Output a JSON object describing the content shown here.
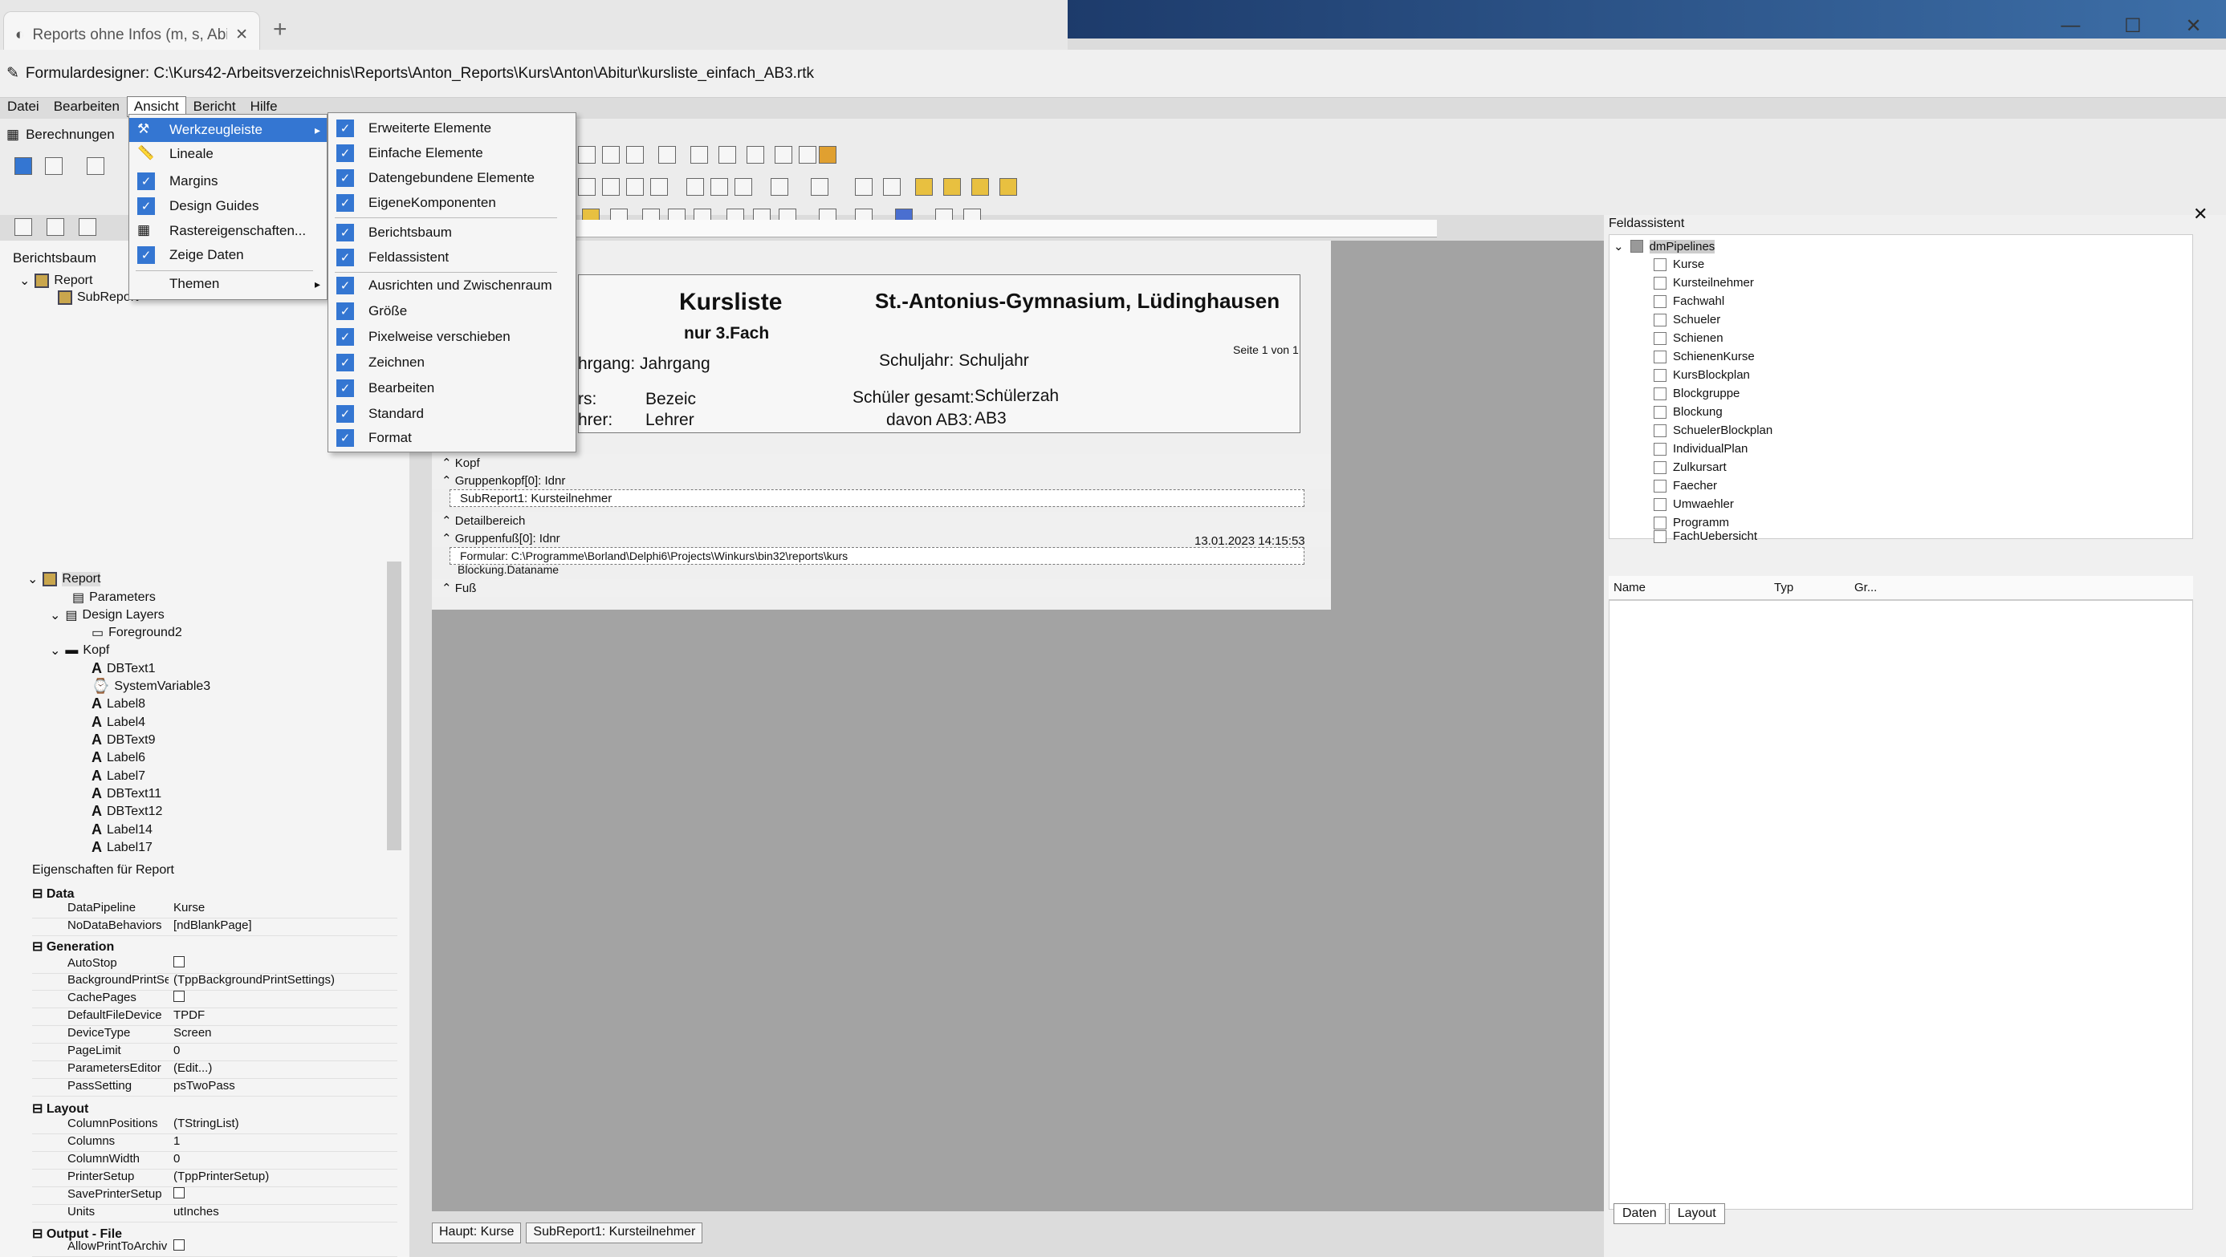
{
  "browser": {
    "tab_title": "Reports ohne Infos (m, s, Abitur)",
    "close_glyph": "✕",
    "new_tab": "+"
  },
  "window": {
    "title": "Formulardesigner: C:\\Kurs42-Arbeitsverzeichnis\\Reports\\Anton_Reports\\Kurs\\Anton\\Abitur\\kursliste_einfach_AB3.rtk",
    "minimize": "—",
    "maximize": "☐",
    "close": "✕"
  },
  "menubar": [
    "Datei",
    "Bearbeiten",
    "Ansicht",
    "Bericht",
    "Hilfe"
  ],
  "toolbar": {
    "calc_label": "Berechnungen"
  },
  "menu_ansicht": [
    {
      "label": "Werkzeugleiste",
      "checked": false,
      "submenu": true
    },
    {
      "label": "Lineale",
      "checked": false
    },
    {
      "label": "Margins",
      "checked": true
    },
    {
      "label": "Design Guides",
      "checked": true
    },
    {
      "label": "Rastereigenschaften...",
      "checked": false
    },
    {
      "label": "Zeige Daten",
      "checked": true
    },
    {
      "label": "Themen",
      "checked": false,
      "submenu": true
    }
  ],
  "menu_werkzeugleiste": [
    "Erweiterte Elemente",
    "Einfache Elemente",
    "Datengebundene Elemente",
    "EigeneKomponenten",
    "Berichtsbaum",
    "Feldassistent",
    "Ausrichten und Zwischenraum",
    "Größe",
    "Pixelweise verschieben",
    "Zeichnen",
    "Bearbeiten",
    "Standard",
    "Format"
  ],
  "left": {
    "tree_title": "Berichtsbaum",
    "tree_top": [
      "Report",
      "SubReport"
    ],
    "tree": [
      "Report",
      "Parameters",
      "Design Layers",
      "Foreground2",
      "Kopf",
      "DBText1",
      "SystemVariable3",
      "Label8",
      "Label4",
      "DBText9",
      "Label6",
      "Label7",
      "DBText11",
      "DBText12",
      "Label14",
      "Label17"
    ],
    "props_title": "Eigenschaften für Report",
    "sections": {
      "data": "Data",
      "generation": "Generation",
      "layout": "Layout",
      "output": "Output - File"
    },
    "props_data": [
      [
        "DataPipeline",
        "Kurse"
      ],
      [
        "NoDataBehaviors",
        "[ndBlankPage]"
      ]
    ],
    "props_generation": [
      [
        "AutoStop",
        ""
      ],
      [
        "BackgroundPrintSe",
        "(TppBackgroundPrintSettings)"
      ],
      [
        "CachePages",
        ""
      ],
      [
        "DefaultFileDevice",
        "TPDF"
      ],
      [
        "DeviceType",
        "Screen"
      ],
      [
        "PageLimit",
        "0"
      ],
      [
        "ParametersEditor",
        "(Edit...)"
      ],
      [
        "PassSetting",
        "psTwoPass"
      ]
    ],
    "props_layout": [
      [
        "ColumnPositions",
        "(TStringList)"
      ],
      [
        "Columns",
        "1"
      ],
      [
        "ColumnWidth",
        "0"
      ],
      [
        "PrinterSetup",
        "(TppPrinterSetup)"
      ],
      [
        "SavePrinterSetup",
        ""
      ],
      [
        "Units",
        "utInches"
      ]
    ],
    "props_output": [
      [
        "AllowPrintToArchiv",
        ""
      ]
    ]
  },
  "report": {
    "title": "Kursliste",
    "school": "St.-Antonius-Gymnasium, Lüdinghausen",
    "subtitle": "nur 3.Fach",
    "jahrgang": "hrgang: Jahrgang",
    "schuljahr": "Schuljahr: Schuljahr",
    "seite": "Seite 1 von 1",
    "kurs_label": "rs:",
    "kurs_value": "Bezeic",
    "lehrer_label": "hrer:",
    "lehrer_value": "Lehrer",
    "schueler_label": "Schüler gesamt:",
    "schueler_value": "Schülerzah",
    "ab3_label": "davon AB3:",
    "ab3_value": "AB3",
    "bands": {
      "kopf": "Kopf",
      "gruppenkopf": "Gruppenkopf[0]: Idnr",
      "subreport": "SubReport1: Kursteilnehmer",
      "detail": "Detailbereich",
      "gruppenfuss": "Gruppenfuß[0]: Idnr",
      "formular": "Formular: C:\\Programme\\Borland\\Delphi6\\Projects\\Winkurs\\bin32\\reports\\kurs",
      "datetime": "13.01.2023 14:15:53",
      "blockung": "Blockung.Dataname",
      "fuss": "Fuß"
    },
    "tabs": [
      "Haupt: Kurse",
      "SubReport1: Kursteilnehmer"
    ]
  },
  "right": {
    "title": "Feldassistent",
    "root": "dmPipelines",
    "items": [
      "Kurse",
      "Kursteilnehmer",
      "Fachwahl",
      "Schueler",
      "Schienen",
      "SchienenKurse",
      "KursBlockplan",
      "Blockgruppe",
      "Blockung",
      "SchuelerBlockplan",
      "IndividualPlan",
      "Zulkursart",
      "Faecher",
      "Umwaehler",
      "Programm",
      "FachUebersicht"
    ],
    "columns": [
      "Name",
      "Typ",
      "Gr..."
    ],
    "tabs": [
      "Daten",
      "Layout"
    ]
  },
  "colors": {
    "menu_highlight": "#3476d2",
    "check_blue": "#3476d2"
  }
}
